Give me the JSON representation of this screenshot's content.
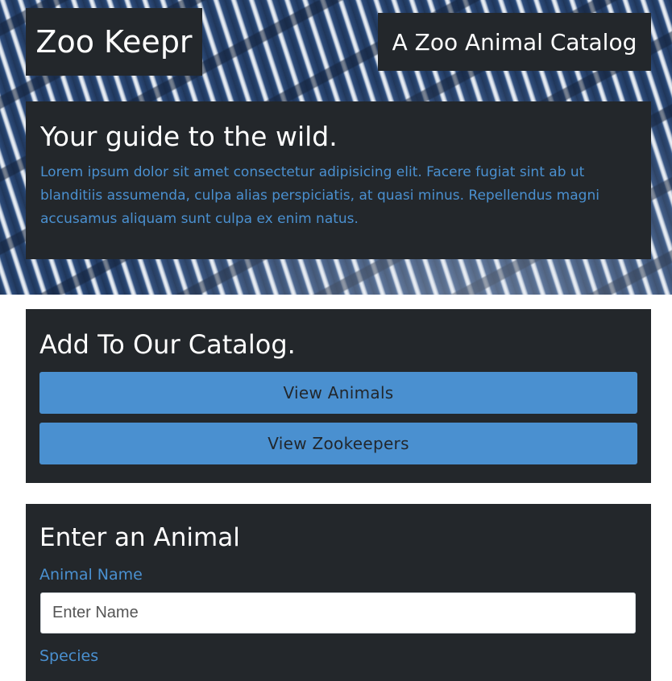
{
  "header": {
    "brand": "Zoo Keepr",
    "tagline": "A Zoo Animal Catalog"
  },
  "intro": {
    "heading": "Your guide to the wild.",
    "body": "Lorem ipsum dolor sit amet consectetur adipisicing elit. Facere fugiat sint ab ut blanditiis assumenda, culpa alias perspiciatis, at quasi minus. Repellendus magni accusamus aliquam sunt culpa ex enim natus."
  },
  "catalog": {
    "heading": "Add To Our Catalog.",
    "view_animals_label": "View Animals",
    "view_zookeepers_label": "View Zookeepers"
  },
  "animal_form": {
    "heading": "Enter an Animal",
    "name_label": "Animal Name",
    "name_placeholder": "Enter Name",
    "name_value": "",
    "species_label": "Species"
  },
  "colors": {
    "accent": "#4a90d0",
    "panel": "#23272b",
    "hero_base": "#22385c"
  },
  "hero_image": "zebra-stripes-background"
}
